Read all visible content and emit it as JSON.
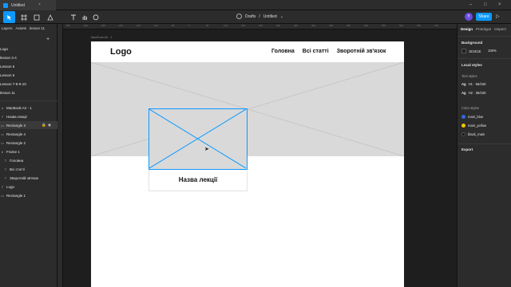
{
  "window": {
    "tab_title": "Untitled",
    "close_glyph": "×",
    "minimize_glyph": "–",
    "maximize_glyph": "□",
    "close_window_glyph": "×"
  },
  "toolbar": {
    "tools": [
      "move-tool",
      "frame-tool",
      "pen-tool",
      "text-tool",
      "hand-tool",
      "comment-tool"
    ],
    "breadcrumb_folder": "Drafts",
    "breadcrumb_sep": "/",
    "breadcrumb_file": "Untitled",
    "avatar_initial": "Y",
    "share_label": "Share",
    "play_glyph": "▷",
    "accent_color": "#0d99ff"
  },
  "left_panel": {
    "tabs": [
      "Layers",
      "Assets",
      "lesson 11"
    ],
    "pages": [
      "Logo",
      "lesson 3-4",
      "Lesson 5",
      "Lesson 6",
      "Lesson 7-8-9-10",
      "lesson 11"
    ],
    "layers": [
      {
        "label": "MacBook Air - 1",
        "icon": "#"
      },
      {
        "label": "Назва лекції",
        "icon": "T"
      },
      {
        "label": "Rectangle 3",
        "icon": "▭",
        "selected": true
      },
      {
        "label": "Rectangle 4",
        "icon": "▭"
      },
      {
        "label": "Rectangle 2",
        "icon": "▭"
      },
      {
        "label": "Frame 1",
        "icon": "#"
      },
      {
        "label": "Головна",
        "icon": "T"
      },
      {
        "label": "Всі статті",
        "icon": "T"
      },
      {
        "label": "Зворотній зв'язок",
        "icon": "T"
      },
      {
        "label": "Logo",
        "icon": "T"
      },
      {
        "label": "Rectangle 1",
        "icon": "▭"
      }
    ]
  },
  "canvas": {
    "ruler_ticks": [
      "-350",
      "-300",
      "-250",
      "-200",
      "-150",
      "-100",
      "-50",
      "0",
      "50",
      "100",
      "150",
      "200",
      "250",
      "300",
      "350",
      "400",
      "450",
      "500",
      "550",
      "600",
      "650",
      "700"
    ],
    "frame_label": "MacBook Air - 1",
    "page": {
      "logo": "Logo",
      "nav": [
        "Головна",
        "Всі статті",
        "Зворотній зв'язок"
      ],
      "card_title": "Назва лекції"
    }
  },
  "right_panel": {
    "tabs": [
      "Design",
      "Prototype",
      "Inspect"
    ],
    "background_title": "Background",
    "background_hex": "1E1E1E",
    "background_opacity": "100%",
    "local_styles_title": "Local styles",
    "text_styles_title": "Text styles",
    "text_styles": [
      {
        "ag": "Ag",
        "label": "H1 · 56/150"
      },
      {
        "ag": "Ag",
        "label": "H2 · 36/150"
      }
    ],
    "color_styles_title": "Color styles",
    "color_styles": [
      {
        "name": "main_blue",
        "color": "#2a6be0"
      },
      {
        "name": "main_yellow",
        "color": "#f5c400"
      },
      {
        "name": "black_main",
        "color": "#111111"
      }
    ],
    "export_title": "Export"
  }
}
